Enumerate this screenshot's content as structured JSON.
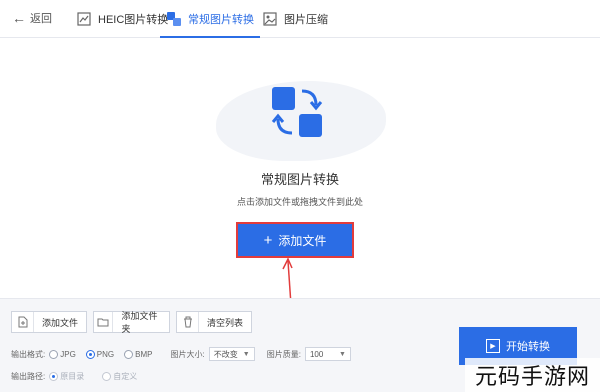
{
  "topbar": {
    "back_label": "返回",
    "tabs": [
      {
        "label": "HEIC图片转换",
        "icon": "heic-convert-icon",
        "active": false
      },
      {
        "label": "常规图片转换",
        "icon": "convert-icon",
        "active": true
      },
      {
        "label": "图片压缩",
        "icon": "image-compress-icon",
        "active": false
      }
    ]
  },
  "main": {
    "heading": "常规图片转换",
    "hint": "点击添加文件或拖拽文件到此处",
    "add_button_label": "添加文件"
  },
  "toolbar": {
    "add_file": "添加文件",
    "add_folder": "添加文件夹",
    "clear_list": "清空列表"
  },
  "settings": {
    "format_label": "输出格式:",
    "formats": [
      "JPG",
      "PNG",
      "BMP"
    ],
    "selected_format": "PNG",
    "size_label": "图片大小:",
    "size_value": "不改变",
    "quality_label": "图片质量:",
    "quality_value": "100",
    "path_label": "输出路径:",
    "path_options": [
      "原目录",
      "自定义"
    ]
  },
  "start_button_label": "开始转换",
  "watermark": "元码手游网",
  "colors": {
    "accent": "#2b6de5",
    "highlight": "#e23c3c"
  }
}
